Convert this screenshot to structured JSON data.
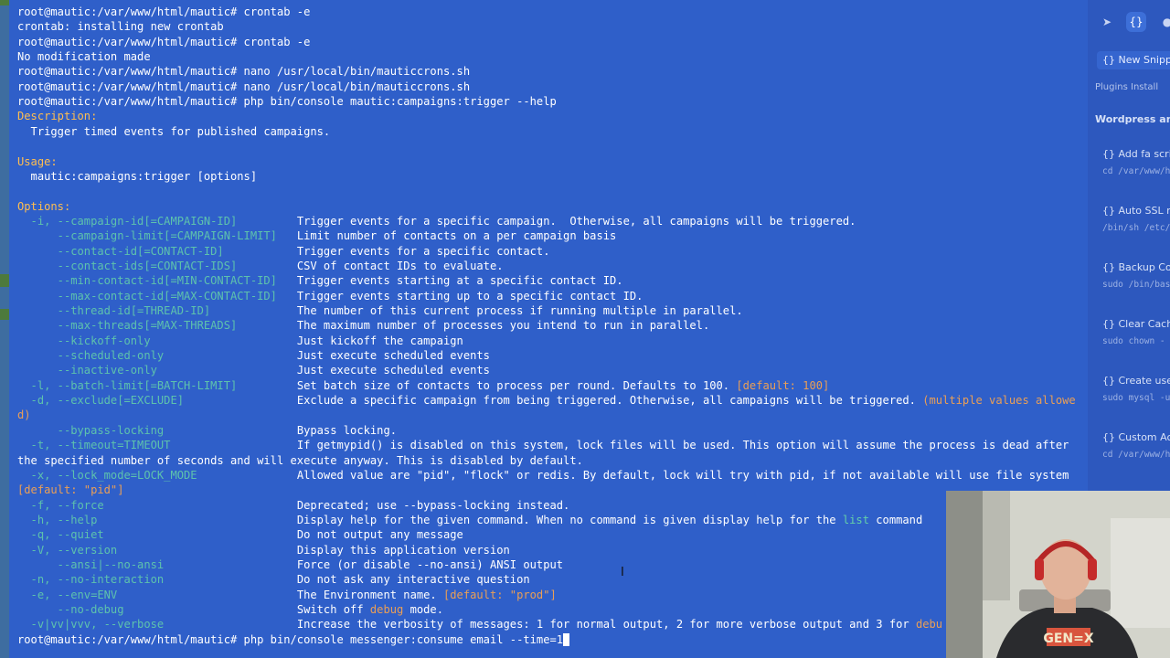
{
  "terminal": {
    "lines": [
      [
        [
          "root@mautic:/var/www/html/mautic# crontab -e",
          ""
        ]
      ],
      [
        [
          "crontab: installing new crontab",
          ""
        ]
      ],
      [
        [
          "root@mautic:/var/www/html/mautic# crontab -e",
          ""
        ]
      ],
      [
        [
          "No modification made",
          ""
        ]
      ],
      [
        [
          "root@mautic:/var/www/html/mautic# nano /usr/local/bin/mauticcrons.sh",
          ""
        ]
      ],
      [
        [
          "root@mautic:/var/www/html/mautic# nano /usr/local/bin/mauticcrons.sh",
          ""
        ]
      ],
      [
        [
          "root@mautic:/var/www/html/mautic# php bin/console mautic:campaigns:trigger --help",
          ""
        ]
      ],
      [
        [
          "Description:",
          "sec"
        ]
      ],
      [
        [
          "  Trigger timed events for published campaigns.",
          ""
        ]
      ],
      [
        [
          "",
          ""
        ]
      ],
      [
        [
          "Usage:",
          "sec"
        ]
      ],
      [
        [
          "  mautic:campaigns:trigger [options]",
          ""
        ]
      ],
      [
        [
          "",
          ""
        ]
      ],
      [
        [
          "Options:",
          "sec"
        ]
      ],
      [
        [
          "  -i, --campaign-id[=CAMPAIGN-ID]         ",
          "opt"
        ],
        [
          "Trigger events for a specific campaign.  Otherwise, all campaigns will be triggered.",
          ""
        ]
      ],
      [
        [
          "      --campaign-limit[=CAMPAIGN-LIMIT]   ",
          "opt"
        ],
        [
          "Limit number of contacts on a per campaign basis",
          ""
        ]
      ],
      [
        [
          "      --contact-id[=CONTACT-ID]           ",
          "opt"
        ],
        [
          "Trigger events for a specific contact.",
          ""
        ]
      ],
      [
        [
          "      --contact-ids[=CONTACT-IDS]         ",
          "opt"
        ],
        [
          "CSV of contact IDs to evaluate.",
          ""
        ]
      ],
      [
        [
          "      --min-contact-id[=MIN-CONTACT-ID]   ",
          "opt"
        ],
        [
          "Trigger events starting at a specific contact ID.",
          ""
        ]
      ],
      [
        [
          "      --max-contact-id[=MAX-CONTACT-ID]   ",
          "opt"
        ],
        [
          "Trigger events starting up to a specific contact ID.",
          ""
        ]
      ],
      [
        [
          "      --thread-id[=THREAD-ID]             ",
          "opt"
        ],
        [
          "The number of this current process if running multiple in parallel.",
          ""
        ]
      ],
      [
        [
          "      --max-threads[=MAX-THREADS]         ",
          "opt"
        ],
        [
          "The maximum number of processes you intend to run in parallel.",
          ""
        ]
      ],
      [
        [
          "      --kickoff-only                      ",
          "opt"
        ],
        [
          "Just kickoff the campaign",
          ""
        ]
      ],
      [
        [
          "      --scheduled-only                    ",
          "opt"
        ],
        [
          "Just execute scheduled events",
          ""
        ]
      ],
      [
        [
          "      --inactive-only                     ",
          "opt"
        ],
        [
          "Just execute scheduled events",
          ""
        ]
      ],
      [
        [
          "  -l, --batch-limit[=BATCH-LIMIT]         ",
          "opt"
        ],
        [
          "Set batch size of contacts to process per round. Defaults to 100. ",
          ""
        ],
        [
          "[default: 100]",
          "dflt"
        ]
      ],
      [
        [
          "  -d, --exclude[=EXCLUDE]                 ",
          "opt"
        ],
        [
          "Exclude a specific campaign from being triggered. Otherwise, all campaigns will be triggered. ",
          ""
        ],
        [
          "(multiple values allowe",
          "dflt"
        ]
      ],
      [
        [
          "d)",
          "dflt"
        ]
      ],
      [
        [
          "      --bypass-locking                    ",
          "opt"
        ],
        [
          "Bypass locking.",
          ""
        ]
      ],
      [
        [
          "  -t, --timeout=TIMEOUT                   ",
          "opt"
        ],
        [
          "If getmypid() is disabled on this system, lock files will be used. This option will assume the process is dead after",
          ""
        ]
      ],
      [
        [
          "the specified number of seconds and will execute anyway. This is disabled by default.",
          ""
        ]
      ],
      [
        [
          "  -x, --lock_mode=LOCK_MODE               ",
          "opt"
        ],
        [
          "Allowed value are \"pid\", \"flock\" or redis. By default, lock will try with pid, if not available will use file system",
          ""
        ]
      ],
      [
        [
          "[default: \"pid\"]",
          "dflt"
        ]
      ],
      [
        [
          "  -f, --force                             ",
          "opt"
        ],
        [
          "Deprecated; use --bypass-locking instead.",
          ""
        ]
      ],
      [
        [
          "  -h, --help                              ",
          "opt"
        ],
        [
          "Display help for the given command. When no command is given display help for the ",
          ""
        ],
        [
          "list",
          "cmdword"
        ],
        [
          " command",
          ""
        ]
      ],
      [
        [
          "  -q, --quiet                             ",
          "opt"
        ],
        [
          "Do not output any message",
          ""
        ]
      ],
      [
        [
          "  -V, --version                           ",
          "opt"
        ],
        [
          "Display this application version",
          ""
        ]
      ],
      [
        [
          "      --ansi|--no-ansi                    ",
          "opt"
        ],
        [
          "Force (or disable --no-ansi) ANSI output",
          ""
        ]
      ],
      [
        [
          "  -n, --no-interaction                    ",
          "opt"
        ],
        [
          "Do not ask any interactive question",
          ""
        ]
      ],
      [
        [
          "  -e, --env=ENV                           ",
          "opt"
        ],
        [
          "The Environment name. ",
          ""
        ],
        [
          "[default: \"prod\"]",
          "dflt"
        ]
      ],
      [
        [
          "      --no-debug                          ",
          "opt"
        ],
        [
          "Switch off ",
          ""
        ],
        [
          "debug",
          "dflt"
        ],
        [
          " mode.",
          ""
        ]
      ],
      [
        [
          "  -v|vv|vvv, --verbose                    ",
          "opt"
        ],
        [
          "Increase the verbosity of messages: 1 for normal output, 2 for more verbose output and 3 for ",
          ""
        ],
        [
          "debu",
          "dflt"
        ]
      ],
      [
        [
          "root@mautic:/var/www/html/mautic# php bin/console messenger:consume email --time=1",
          ""
        ],
        [
          "",
          "cursor"
        ]
      ]
    ]
  },
  "panel": {
    "new_snippet": "{} New Snipp",
    "category_partial": "Plugins Install",
    "category": "Wordpress and",
    "snippets": [
      {
        "title": "{} Add fa scrip",
        "cmd": "cd /var/www/h"
      },
      {
        "title": "{} Auto SSL re",
        "cmd": "/bin/sh /etc/"
      },
      {
        "title": "{} Backup Cop",
        "cmd": "sudo /bin/bas"
      },
      {
        "title": "{} Clear Cach",
        "cmd": "sudo chown -"
      },
      {
        "title": "{} Create user",
        "cmd": "sudo mysql -u"
      },
      {
        "title": "{} Custom Act",
        "cmd": "cd /var/www/h"
      }
    ]
  },
  "colors": {
    "terminal_bg": "#2f5fc9",
    "option_text": "#7aff9c",
    "section_header": "#ffbe50",
    "default_value": "#ffa64a"
  }
}
